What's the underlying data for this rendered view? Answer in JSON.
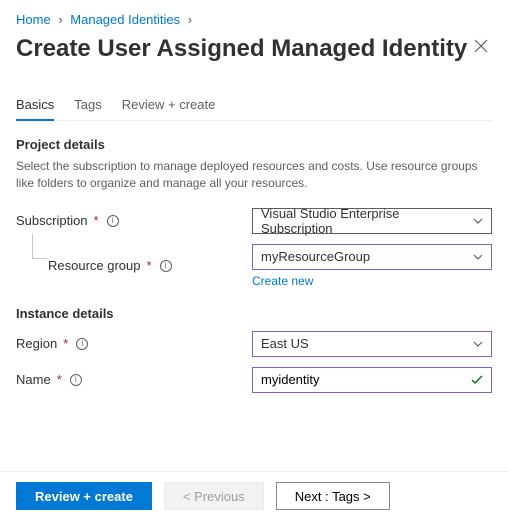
{
  "breadcrumb": {
    "home": "Home",
    "managed_identities": "Managed Identities"
  },
  "title": "Create User Assigned Managed Identity",
  "tabs": {
    "basics": "Basics",
    "tags": "Tags",
    "review": "Review + create"
  },
  "project_details": {
    "heading": "Project details",
    "description": "Select the subscription to manage deployed resources and costs. Use resource groups like folders to organize and manage all your resources.",
    "subscription_label": "Subscription",
    "subscription_value": "Visual Studio Enterprise Subscription",
    "resource_group_label": "Resource group",
    "resource_group_value": "myResourceGroup",
    "create_new": "Create new"
  },
  "instance_details": {
    "heading": "Instance details",
    "region_label": "Region",
    "region_value": "East US",
    "name_label": "Name",
    "name_value": "myidentity"
  },
  "footer": {
    "review": "Review + create",
    "previous": "< Previous",
    "next": "Next : Tags >"
  }
}
